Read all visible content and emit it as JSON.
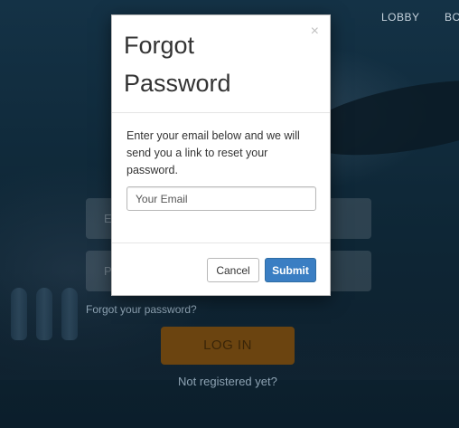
{
  "nav": {
    "items": [
      "LOBBY",
      "BO"
    ]
  },
  "login_form": {
    "email_placeholder": "E",
    "password_placeholder": "P",
    "forgot_link": "Forgot your password?",
    "login_button": "LOG IN",
    "register_link": "Not registered yet?"
  },
  "modal": {
    "title": "Forgot Password",
    "close_symbol": "×",
    "description": "Enter your email below and we will send you a link to reset your password.",
    "email_placeholder": "Your Email",
    "email_value": "",
    "cancel_label": "Cancel",
    "submit_label": "Submit"
  },
  "colors": {
    "accent": "#3a7ec3",
    "login_button_dimmed": "#6b4410",
    "overlay_background": "#0e2231"
  }
}
